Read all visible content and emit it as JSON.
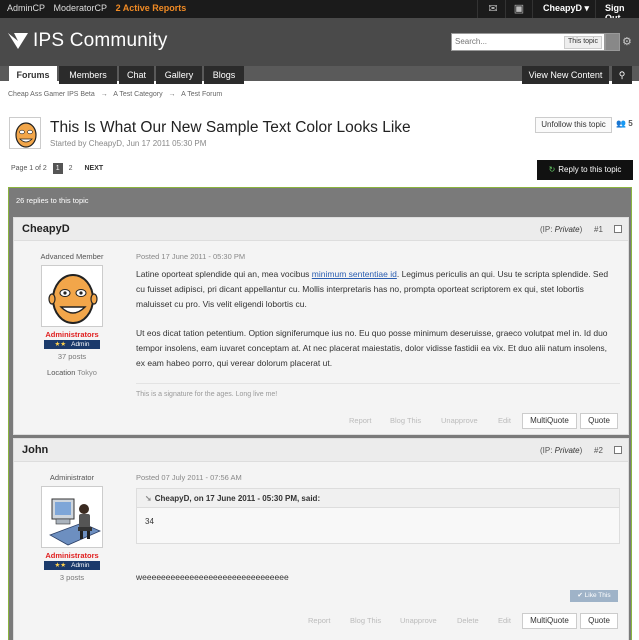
{
  "adminbar": {
    "admincp": "AdminCP",
    "moderatorcp": "ModeratorCP",
    "reports": "2 Active Reports",
    "user": "CheapyD",
    "signout": "Sign Out"
  },
  "header": {
    "site_name": "IPS Community",
    "search_placeholder": "Search...",
    "search_scope": "This topic"
  },
  "nav": {
    "tabs": [
      "Forums",
      "Members",
      "Chat",
      "Gallery",
      "Blogs"
    ],
    "view_new": "View New Content"
  },
  "breadcrumb": [
    "Cheap Ass Gamer IPS Beta",
    "A Test Category",
    "A Test Forum"
  ],
  "topic": {
    "title": "This Is What Our New Sample Text Color Looks Like",
    "meta": "Started by CheapyD, Jun 17 2011 05:30 PM",
    "unfollow": "Unfollow this topic",
    "viewers": "5",
    "page_label": "Page 1 of 2",
    "pages": [
      "1",
      "2"
    ],
    "next": "NEXT",
    "reply": "Reply to this topic",
    "replies_count": "26 replies to this topic"
  },
  "posts": [
    {
      "author": "CheapyD",
      "ip_label": "(IP: ",
      "ip_value": "Private",
      "ip_close": ")",
      "number": "#1",
      "member_title": "Advanced Member",
      "group": "Administrators",
      "rank_stars": "★★",
      "rank": "Admin",
      "postcount": "37 posts",
      "location_label": "Location",
      "location": "Tokyo",
      "date": "Posted 17 June 2011 - 05:30 PM",
      "para1_a": "Latine oporteat splendide qui an, mea vocibus ",
      "para1_link": "minimum sententiae id",
      "para1_b": ". Legimus periculis an qui. Usu te scripta splendide. Sed cu fuisset adipisci, pri dicant appellantur cu. Mollis interpretaris has no, prompta oporteat scriptorem ex qui, stet lobortis maluisset cu pro. Vis velit eligendi lobortis cu.",
      "para2": "Ut eos dicat tation petentium. Option signiferumque ius no. Eu quo posse minimum deseruisse, graeco volutpat mel in. Id duo tempor insolens, eam iuvaret conceptam at. At nec placerat maiestatis, dolor vidisse fastidii ea vix. Et duo alii natum insolens, ex eam habeo porro, qui verear dolorum placerat ut.",
      "signature": "This is a signature for the ages. Long live me!",
      "actions": [
        "Report",
        "Blog This",
        "Unapprove",
        "Edit"
      ],
      "multiquote": "MultiQuote",
      "quote": "Quote"
    },
    {
      "author": "John",
      "ip_label": "(IP: ",
      "ip_value": "Private",
      "ip_close": ")",
      "number": "#2",
      "member_title": "Administrator",
      "group": "Administrators",
      "rank_stars": "★★",
      "rank": "Admin",
      "postcount": "3 posts",
      "date": "Posted 07 July 2011 - 07:56 AM",
      "quote_head": "CheapyD, on 17 June 2011 - 05:30 PM, said:",
      "quote_text": "34",
      "body": "weeeeeeeeeeeeeeeeeeeeeeeeeeeeeee",
      "like": "Like This",
      "actions": [
        "Report",
        "Blog This",
        "Unapprove",
        "Delete",
        "Edit"
      ],
      "multiquote": "MultiQuote",
      "quote": "Quote"
    }
  ],
  "colors": {
    "accent_green": "#8bb43e",
    "reports_orange": "#f08a24",
    "group_red": "#e02020",
    "rank_navy": "#1b3a6b"
  }
}
